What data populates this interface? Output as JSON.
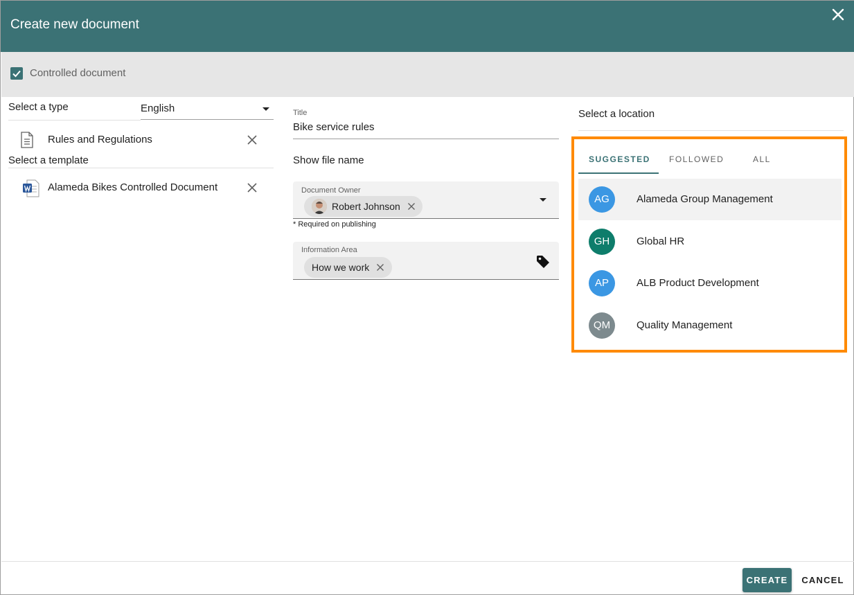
{
  "dialog": {
    "title": "Create new document"
  },
  "controlled": {
    "label": "Controlled document",
    "checked": true
  },
  "left": {
    "type_label": "Select a type",
    "language_value": "English",
    "type_item": {
      "label": "Rules and Regulations",
      "icon": "document-icon"
    },
    "template_label": "Select a template",
    "template_item": {
      "label": "Alameda Bikes Controlled Document",
      "icon": "word-icon"
    }
  },
  "middle": {
    "title_label": "Title",
    "title_value": "Bike service rules",
    "show_file_name": "Show file name",
    "owner_label": "Document Owner",
    "owner_chip": "Robert Johnson",
    "required_note": "* Required on publishing",
    "area_label": "Information Area",
    "area_chip": "How we work"
  },
  "location": {
    "label": "Select a location",
    "tabs": [
      {
        "label": "SUGGESTED",
        "active": true
      },
      {
        "label": "FOLLOWED",
        "active": false
      },
      {
        "label": "ALL",
        "active": false
      }
    ],
    "items": [
      {
        "initials": "AG",
        "name": "Alameda Group Management",
        "color": "#3b97e3"
      },
      {
        "initials": "GH",
        "name": "Global HR",
        "color": "#0e7d6b"
      },
      {
        "initials": "AP",
        "name": "ALB Product Development",
        "color": "#3b97e3"
      },
      {
        "initials": "QM",
        "name": "Quality Management",
        "color": "#7d8a8e"
      }
    ]
  },
  "footer": {
    "create_label": "CREATE",
    "cancel_label": "CANCEL"
  },
  "colors": {
    "header": "#3b7275",
    "highlight_border": "#ff8a00"
  }
}
